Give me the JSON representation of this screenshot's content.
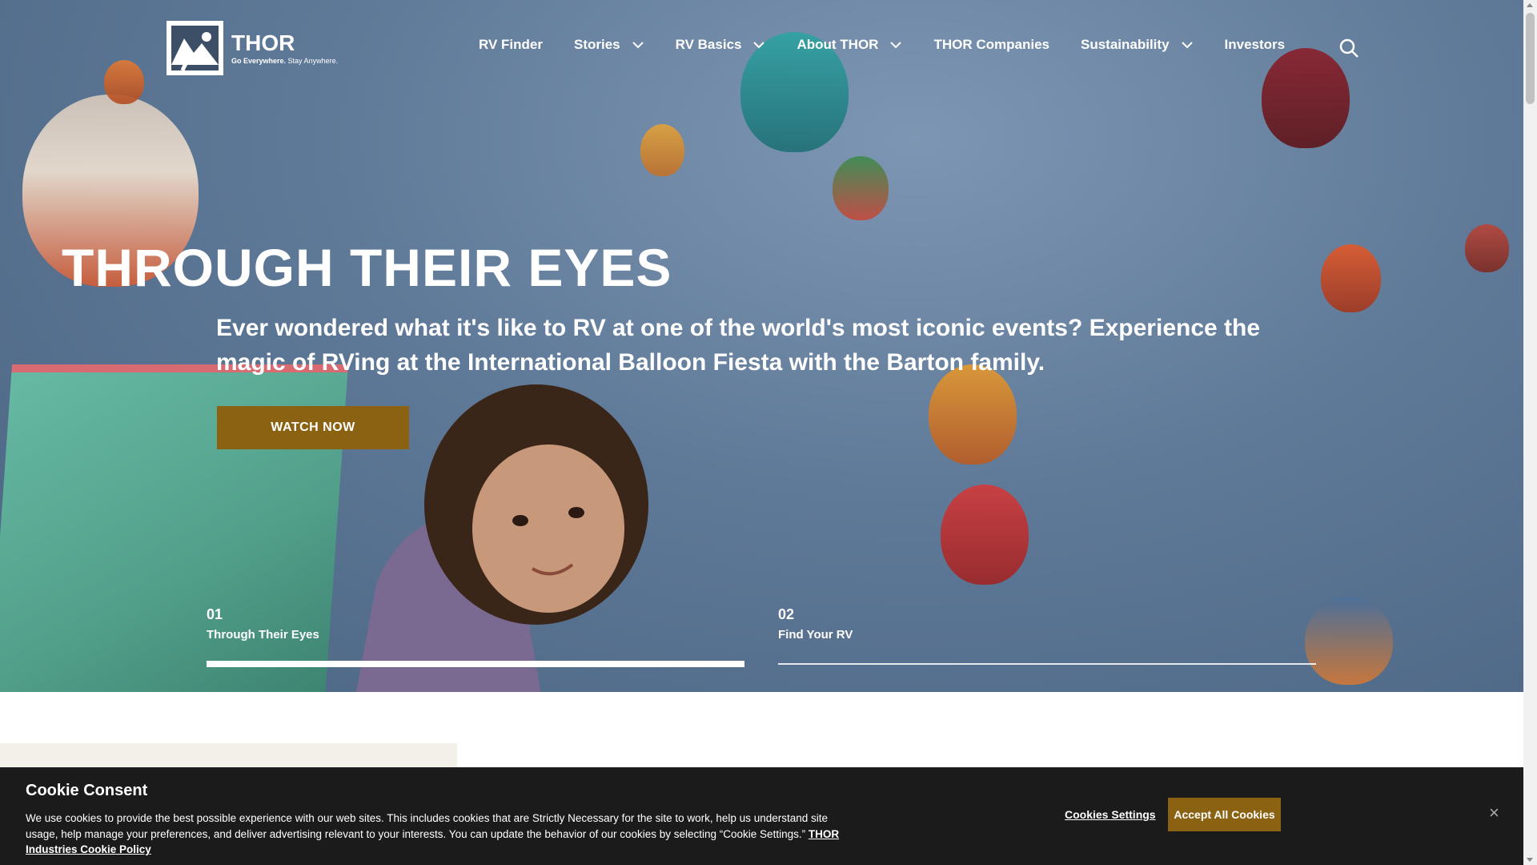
{
  "header": {
    "logo": {
      "name": "THOR",
      "tagline_bold": "Go Everywhere.",
      "tagline_rest": " Stay Anywhere."
    },
    "nav": [
      {
        "label": "RV Finder",
        "dropdown": false
      },
      {
        "label": "Stories",
        "dropdown": true
      },
      {
        "label": "RV Basics",
        "dropdown": true
      },
      {
        "label": "About THOR",
        "dropdown": true
      },
      {
        "label": "THOR Companies",
        "dropdown": false
      },
      {
        "label": "Sustainability",
        "dropdown": true
      },
      {
        "label": "Investors",
        "dropdown": false
      }
    ],
    "search_icon": "search-icon"
  },
  "hero": {
    "title": "THROUGH THEIR EYES",
    "subtitle": "Ever wondered what it's like to RV at one of the world's most iconic events? Experience the magic of RVing at the International Balloon Fiesta with the Barton family.",
    "cta": "WATCH NOW",
    "slides": [
      {
        "num": "01",
        "label": "Through Their Eyes",
        "progress": 1.0
      },
      {
        "num": "02",
        "label": "Find Your RV",
        "progress": 0.0
      }
    ]
  },
  "cookie": {
    "title": "Cookie Consent",
    "text": "We use cookies to provide the best possible experience with our web sites. This includes cookies that are Strictly Necessary for the site to work, help us understand site usage, help manage your preferences, and deliver advertising relevant to your interests. You can update the behavior of our cookies by selecting “Cookie Settings.”",
    "link": "THOR Industries Cookie Policy",
    "settings": "Cookies Settings",
    "accept": "Accept All Cookies",
    "close": "×"
  },
  "colors": {
    "accent": "#8b6212",
    "banner": "#1b1b1b",
    "sky": "#5f7a98"
  }
}
